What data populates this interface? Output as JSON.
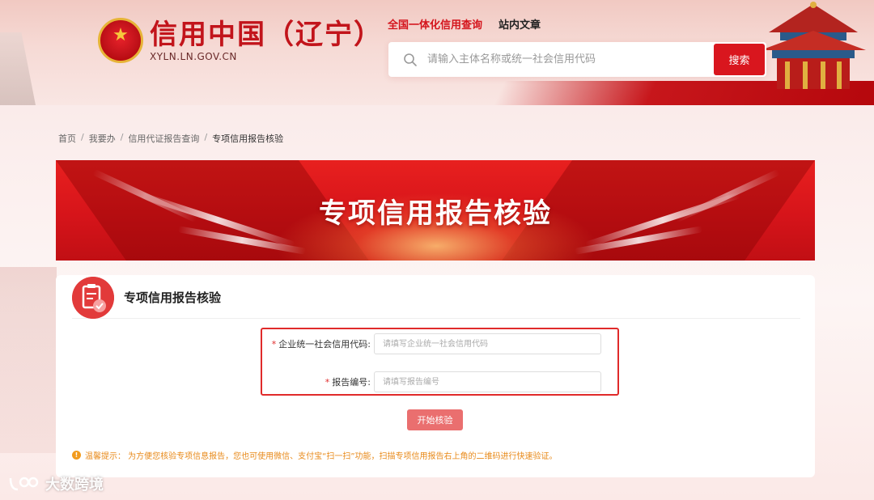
{
  "header": {
    "logo_title": "信用中国（辽宁）",
    "logo_sub": "XYLN.LN.GOV.CN",
    "nav": [
      {
        "label": "全国一体化信用查询",
        "active": true
      },
      {
        "label": "站内文章",
        "active": false
      }
    ],
    "search": {
      "placeholder": "请输入主体名称或统一社会信用代码",
      "button_label": "搜索"
    }
  },
  "breadcrumb": [
    "首页",
    "我要办",
    "信用代证报告查询",
    "专项信用报告核验"
  ],
  "banner": {
    "title": "专项信用报告核验"
  },
  "card": {
    "title": "专项信用报告核验",
    "fields": [
      {
        "required_mark": "*",
        "label": "企业统一社会信用代码:",
        "placeholder": "请填写企业统一社会信用代码"
      },
      {
        "required_mark": "*",
        "label": "报告编号:",
        "placeholder": "请填写报告编号"
      }
    ],
    "submit_label": "开始核验",
    "tip_icon": "!",
    "tip": "温馨提示：  为方便您核验专项信息报告，您也可使用微信、支付宝“扫一扫”功能，扫描专项信用报告右上角的二维码进行快速验证。"
  },
  "watermark": "大数跨境",
  "colors": {
    "brand_red": "#d9161e",
    "highlight_border": "#e02a2a",
    "submit_button": "#ea6f6f",
    "tip": "#e88a1a"
  }
}
